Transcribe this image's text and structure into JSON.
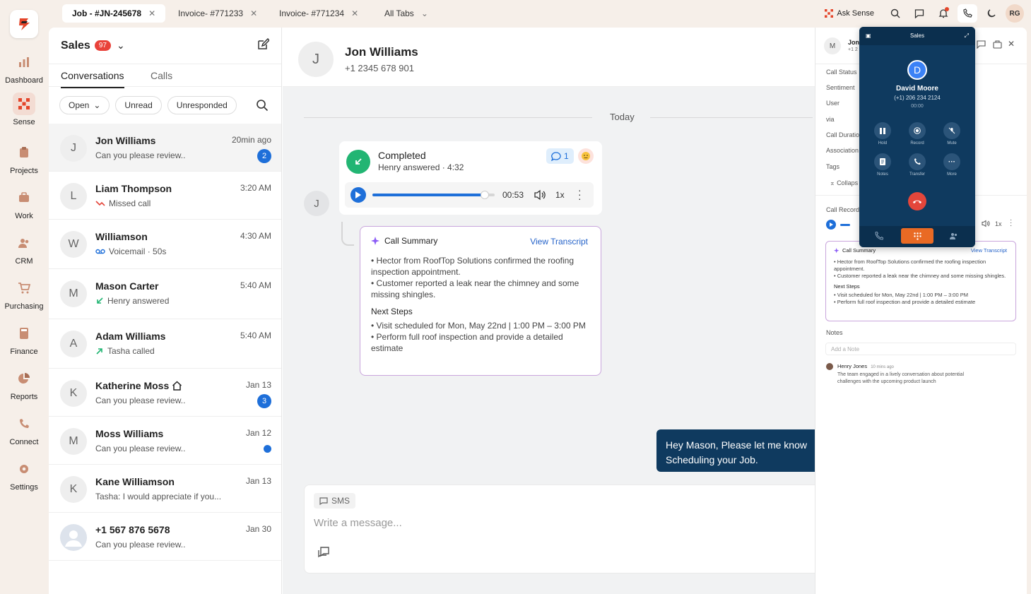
{
  "rail": {
    "items": [
      {
        "label": "Dashboard",
        "icon": "bar-chart-icon"
      },
      {
        "label": "Sense",
        "icon": "sense-icon"
      },
      {
        "label": "Projects",
        "icon": "clipboard-icon"
      },
      {
        "label": "Work",
        "icon": "briefcase-icon"
      },
      {
        "label": "CRM",
        "icon": "users-icon"
      },
      {
        "label": "Purchasing",
        "icon": "cart-icon"
      },
      {
        "label": "Finance",
        "icon": "calculator-icon"
      },
      {
        "label": "Reports",
        "icon": "pie-chart-icon"
      },
      {
        "label": "Connect",
        "icon": "phone-network-icon"
      },
      {
        "label": "Settings",
        "icon": "gear-icon"
      }
    ]
  },
  "tabs": [
    {
      "label": "Job - #JN-245678"
    },
    {
      "label": "Invoice- #771233"
    },
    {
      "label": "Invoice- #771234"
    },
    {
      "label": "All Tabs"
    }
  ],
  "topbar": {
    "ask_sense": "Ask Sense",
    "user_initials": "RG"
  },
  "convlist": {
    "title": "Sales",
    "badge": "97",
    "tabs": [
      "Conversations",
      "Calls"
    ],
    "filters": [
      "Open",
      "Unread",
      "Unresponded"
    ],
    "items": [
      {
        "initial": "J",
        "name": "Jon Williams",
        "sub": "Can you please review..",
        "time": "20min ago",
        "count": "2"
      },
      {
        "initial": "L",
        "name": "Liam Thompson",
        "sub": "Missed call",
        "time": "3:20 AM"
      },
      {
        "initial": "W",
        "name": "Williamson",
        "sub": "Voicemail · 50s",
        "time": "4:30 AM"
      },
      {
        "initial": "M",
        "name": "Mason Carter",
        "sub": "Henry answered",
        "time": "5:40 AM"
      },
      {
        "initial": "A",
        "name": "Adam Williams",
        "sub": "Tasha called",
        "time": "5:40 AM"
      },
      {
        "initial": "K",
        "name": "Katherine Moss",
        "sub": "Can you please review..",
        "time": "Jan 13",
        "count": "3"
      },
      {
        "initial": "M",
        "name": "Moss Williams",
        "sub": "Can you please review..",
        "time": "Jan 12"
      },
      {
        "initial": "K",
        "name": "Kane Williamson",
        "sub": "Tasha: I would appreciate if you...",
        "time": "Jan 13"
      },
      {
        "initial": "",
        "name": "+1 567 876 5678",
        "sub": "Can you please review..",
        "time": "Jan 30"
      }
    ]
  },
  "chat": {
    "contact_initial": "J",
    "contact_name": "Jon Williams",
    "contact_phone": "+1 2345 678 901",
    "day_label": "Today",
    "call": {
      "status": "Completed",
      "detail": "Henry answered · 4:32",
      "comments": "1",
      "elapsed": "00:53",
      "speed": "1x",
      "progress": 0.92
    },
    "summary": {
      "title": "Call Summary",
      "view_transcript": "View Transcript",
      "b1": "• Hector from RoofTop Solutions confirmed the roofing inspection appointment.",
      "b2": "• Customer reported a leak near the chimney and some missing shingles.",
      "next_title": "Next Steps",
      "n1": "• Visit scheduled for Mon, May 22nd | 1:00 PM – 3:00 PM",
      "n2": "• Perform full roof inspection and provide a detailed estimate"
    },
    "outgoing_line1": "Hey Mason, Please let me know",
    "outgoing_line2": "Scheduling your Job.",
    "composer_channel": "SMS",
    "composer_placeholder": "Write a message..."
  },
  "rpanel": {
    "initial": "M",
    "name": "Jon",
    "phone": "+1 2",
    "fields": [
      "Call Status",
      "Sentiment",
      "User",
      "via",
      "Call Duratio",
      "Association",
      "Tags"
    ],
    "collapse": "Collaps",
    "call_recording": "Call Record",
    "speed": "1x",
    "summary_title": "Call Summary",
    "view_transcript": "View Transcript",
    "s1": "• Hector from RoofTop Solutions confirmed the roofing inspection appointment.",
    "s2": "• Customer reported a leak near the chimney and some missing shingles.",
    "next_title": "Next Steps",
    "s3": "• Visit scheduled for Mon, May 22nd | 1:00 PM – 3:00 PM",
    "s4": "• Perform full roof inspection and provide a detailed estimate",
    "notes_label": "Notes",
    "note_placeholder": "Add a Note",
    "note_author": "Henry Jones",
    "note_time": "10 mins ago",
    "note_text1": "The team engaged in a lively conversation about potential",
    "note_text2": "challenges with the upcoming product launch"
  },
  "dialer": {
    "title": "Sales",
    "initial": "D",
    "name": "David Moore",
    "phone": "(+1) 206 234 2124",
    "timer": "00:00",
    "buttons": [
      "Hold",
      "Record",
      "Mute",
      "Notes",
      "Transfer",
      "More"
    ]
  },
  "colors": {
    "accent": "#e96a24",
    "primary_blue": "#1e6fd9",
    "navy": "#0f3a5f",
    "success": "#22b573",
    "danger": "#e4463b"
  }
}
